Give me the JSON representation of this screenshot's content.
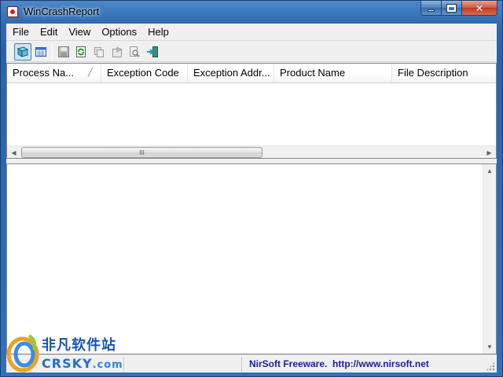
{
  "window": {
    "title": "WinCrashReport",
    "controls": {
      "minimize": "minimize-icon",
      "maximize": "maximize-icon",
      "close": "✕"
    }
  },
  "menubar": {
    "items": [
      "File",
      "Edit",
      "View",
      "Options",
      "Help"
    ]
  },
  "toolbar": {
    "icons": [
      "open-crash-report-icon",
      "html-report-icon",
      "save-icon",
      "refresh-icon",
      "copy-icon",
      "properties-icon",
      "find-icon",
      "exit-icon"
    ],
    "pressed": "open-crash-report-icon"
  },
  "listview": {
    "columns": [
      "Process Na...",
      "Exception Code",
      "Exception Addr...",
      "Product Name",
      "File Description"
    ],
    "sort_column": "Process Na...",
    "rows": []
  },
  "scrollbar": {
    "thumb_glyph": "III"
  },
  "statusbar": {
    "left_text": "",
    "link_text": "NirSoft Freeware.  http://www.nirsoft.net"
  },
  "watermark": {
    "chinese": "非凡软件站",
    "latin": "CRSKY",
    "domain": ".com"
  },
  "colors": {
    "titlebar": "#3470b7",
    "link": "#1a1aa6",
    "pressed_button": "#cde4f7",
    "watermark": "#1a55b0"
  }
}
